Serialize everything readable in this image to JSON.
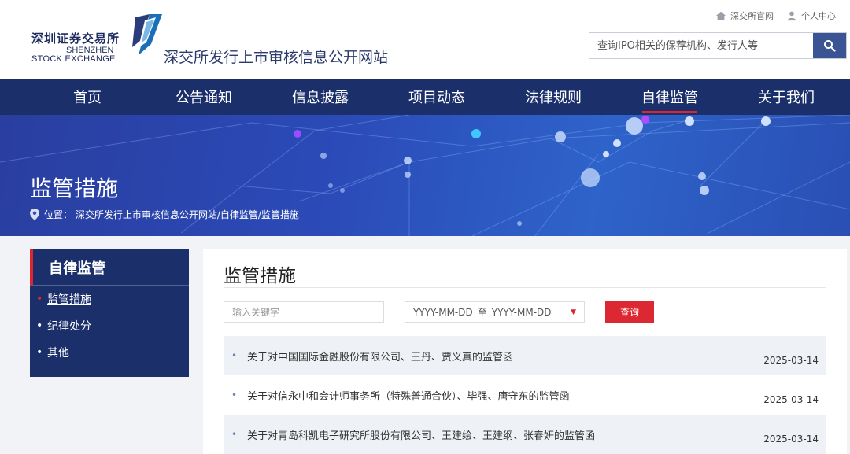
{
  "header": {
    "logo_cn": "深圳证券交易所",
    "logo_en1": "SHENZHEN",
    "logo_en2": "STOCK EXCHANGE",
    "site_title": "深交所发行上市审核信息公开网站",
    "toplinks": [
      "深交所官网",
      "个人中心"
    ],
    "search_placeholder": "查询IPO相关的保荐机构、发行人等"
  },
  "nav": {
    "items": [
      "首页",
      "公告通知",
      "信息披露",
      "项目动态",
      "法律规则",
      "自律监管",
      "关于我们"
    ],
    "active": "自律监管"
  },
  "banner": {
    "title": "监管措施",
    "breadcrumb": "位置：  深交所发行上市审核信息公开网站/自律监管/监管措施"
  },
  "sidebar": {
    "heading": "自律监管",
    "items": [
      "监管措施",
      "纪律处分",
      "其他"
    ],
    "active": "监管措施"
  },
  "content": {
    "title": "监管措施",
    "keyword_placeholder": "输入关键字",
    "date_from": "YYYY-MM-DD",
    "date_sep": "至",
    "date_to": "YYYY-MM-DD",
    "query_label": "查询",
    "rows": [
      {
        "title": "关于对中国国际金融股份有限公司、王丹、贾义真的监管函",
        "date": "2025-03-14"
      },
      {
        "title": "关于对信永中和会计师事务所（特殊普通合伙）、毕强、唐守东的监管函",
        "date": "2025-03-14"
      },
      {
        "title": "关于对青岛科凯电子研究所股份有限公司、王建绘、王建纲、张春妍的监管函",
        "date": "2025-03-14"
      }
    ]
  },
  "colors": {
    "nav_bg": "#1b2f6b",
    "accent_red": "#e1232f",
    "search_btn": "#3b5494"
  },
  "icons": [
    "home-icon",
    "user-icon",
    "search-icon",
    "location-pin-icon",
    "szse-logo-icon"
  ]
}
